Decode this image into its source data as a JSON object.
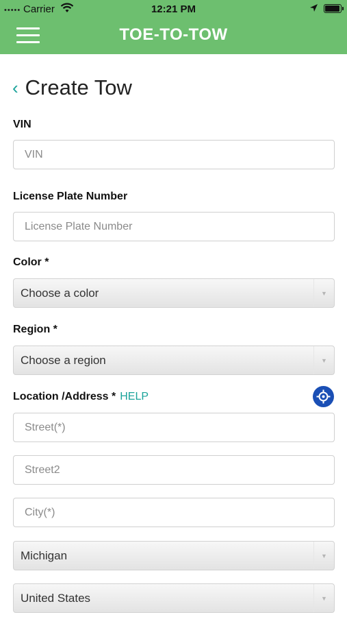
{
  "status_bar": {
    "carrier": "Carrier",
    "time": "12:21 PM"
  },
  "header": {
    "app_title": "TOE-TO-TOW"
  },
  "page": {
    "title": "Create Tow"
  },
  "form": {
    "vin": {
      "label": "VIN",
      "placeholder": "VIN"
    },
    "license_plate": {
      "label": "License Plate Number",
      "placeholder": "License Plate Number"
    },
    "color": {
      "label": "Color *",
      "value": "Choose a color"
    },
    "region": {
      "label": "Region *",
      "value": "Choose a region"
    },
    "location": {
      "label": "Location /Address *",
      "help": "HELP",
      "street_placeholder": "Street(*)",
      "street2_placeholder": "Street2",
      "city_placeholder": "City(*)",
      "state_value": "Michigan",
      "country_value": "United States"
    }
  },
  "colors": {
    "header_green": "#6dbf6f",
    "accent_teal": "#1aa39a",
    "locate_blue": "#1a4fb5"
  }
}
